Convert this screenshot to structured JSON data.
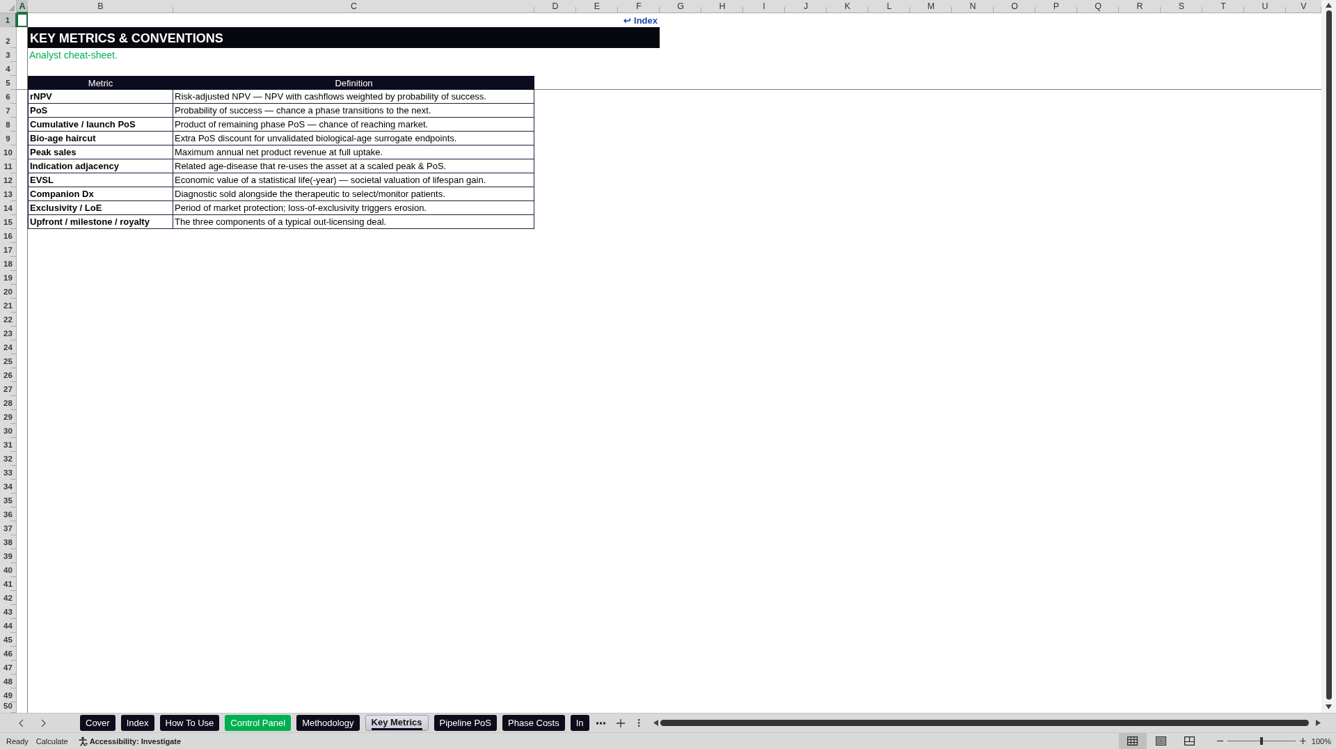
{
  "sheet": {
    "column_headers": [
      {
        "label": "A",
        "selected": true
      },
      {
        "label": "B",
        "selected": false
      },
      {
        "label": "C",
        "selected": false
      },
      {
        "label": "D",
        "selected": false
      },
      {
        "label": "E",
        "selected": false
      },
      {
        "label": "F",
        "selected": false
      },
      {
        "label": "G",
        "selected": false
      },
      {
        "label": "H",
        "selected": false
      },
      {
        "label": "I",
        "selected": false
      },
      {
        "label": "J",
        "selected": false
      },
      {
        "label": "K",
        "selected": false
      },
      {
        "label": "L",
        "selected": false
      },
      {
        "label": "M",
        "selected": false
      },
      {
        "label": "N",
        "selected": false
      },
      {
        "label": "O",
        "selected": false
      },
      {
        "label": "P",
        "selected": false
      },
      {
        "label": "Q",
        "selected": false
      },
      {
        "label": "R",
        "selected": false
      },
      {
        "label": "S",
        "selected": false
      },
      {
        "label": "T",
        "selected": false
      },
      {
        "label": "U",
        "selected": false
      },
      {
        "label": "V",
        "selected": false
      }
    ],
    "row_headers": [
      {
        "label": "1",
        "selected": true
      },
      {
        "label": "2",
        "selected": false
      },
      {
        "label": "3",
        "selected": false
      },
      {
        "label": "4",
        "selected": false
      },
      {
        "label": "5",
        "selected": false
      },
      {
        "label": "6",
        "selected": false
      },
      {
        "label": "7",
        "selected": false
      },
      {
        "label": "8",
        "selected": false
      },
      {
        "label": "9",
        "selected": false
      },
      {
        "label": "10",
        "selected": false
      },
      {
        "label": "11",
        "selected": false
      },
      {
        "label": "12",
        "selected": false
      },
      {
        "label": "13",
        "selected": false
      },
      {
        "label": "14",
        "selected": false
      },
      {
        "label": "15",
        "selected": false
      },
      {
        "label": "16",
        "selected": false
      },
      {
        "label": "17",
        "selected": false
      },
      {
        "label": "18",
        "selected": false
      },
      {
        "label": "19",
        "selected": false
      },
      {
        "label": "20",
        "selected": false
      },
      {
        "label": "21",
        "selected": false
      },
      {
        "label": "22",
        "selected": false
      },
      {
        "label": "23",
        "selected": false
      },
      {
        "label": "24",
        "selected": false
      },
      {
        "label": "25",
        "selected": false
      },
      {
        "label": "26",
        "selected": false
      },
      {
        "label": "27",
        "selected": false
      },
      {
        "label": "28",
        "selected": false
      },
      {
        "label": "29",
        "selected": false
      },
      {
        "label": "30",
        "selected": false
      },
      {
        "label": "31",
        "selected": false
      },
      {
        "label": "32",
        "selected": false
      },
      {
        "label": "33",
        "selected": false
      },
      {
        "label": "34",
        "selected": false
      },
      {
        "label": "35",
        "selected": false
      },
      {
        "label": "36",
        "selected": false
      },
      {
        "label": "37",
        "selected": false
      },
      {
        "label": "38",
        "selected": false
      },
      {
        "label": "39",
        "selected": false
      },
      {
        "label": "40",
        "selected": false
      },
      {
        "label": "41",
        "selected": false
      },
      {
        "label": "42",
        "selected": false
      },
      {
        "label": "43",
        "selected": false
      },
      {
        "label": "44",
        "selected": false
      },
      {
        "label": "45",
        "selected": false
      },
      {
        "label": "46",
        "selected": false
      },
      {
        "label": "47",
        "selected": false
      },
      {
        "label": "48",
        "selected": false
      },
      {
        "label": "49",
        "selected": false
      },
      {
        "label": "50",
        "selected": false
      }
    ]
  },
  "index_link": {
    "label": "↩ Index"
  },
  "title": "KEY METRICS & CONVENTIONS",
  "subtitle": "Analyst cheat-sheet.",
  "table": {
    "columns": [
      "Metric",
      "Definition"
    ],
    "rows": [
      {
        "metric": "rNPV",
        "definition": "Risk-adjusted NPV — NPV with cashflows weighted by probability of success."
      },
      {
        "metric": "PoS",
        "definition": "Probability of success — chance a phase transitions to the next."
      },
      {
        "metric": "Cumulative / launch PoS",
        "definition": "Product of remaining phase PoS — chance of reaching market."
      },
      {
        "metric": "Bio-age haircut",
        "definition": "Extra PoS discount for unvalidated biological-age surrogate endpoints."
      },
      {
        "metric": "Peak sales",
        "definition": "Maximum annual net product revenue at full uptake."
      },
      {
        "metric": "Indication adjacency",
        "definition": "Related age-disease that re-uses the asset at a scaled peak & PoS."
      },
      {
        "metric": "EVSL",
        "definition": "Economic value of a statistical life(-year) — societal valuation of lifespan gain."
      },
      {
        "metric": "Companion Dx",
        "definition": "Diagnostic sold alongside the therapeutic to select/monitor patients."
      },
      {
        "metric": "Exclusivity / LoE",
        "definition": "Period of market protection; loss-of-exclusivity triggers erosion."
      },
      {
        "metric": "Upfront / milestone / royalty",
        "definition": "The three components of a typical out-licensing deal."
      }
    ]
  },
  "sheet_tabs": [
    {
      "label": "Cover",
      "selected": false,
      "color": "#0c0c1a"
    },
    {
      "label": "Index",
      "selected": false,
      "color": "#0c0c1a"
    },
    {
      "label": "How To Use",
      "selected": false,
      "color": "#0c0c1a"
    },
    {
      "label": "Control Panel",
      "selected": false,
      "color": "#00b050"
    },
    {
      "label": "Methodology",
      "selected": false,
      "color": "#0c0c1a"
    },
    {
      "label": "Key Metrics",
      "selected": true,
      "color": "#0c0c1a"
    },
    {
      "label": "Pipeline PoS",
      "selected": false,
      "color": "#0c0c1a"
    },
    {
      "label": "Phase Costs",
      "selected": false,
      "color": "#0c0c1a"
    },
    {
      "label": "In",
      "selected": false,
      "color": "#0c0c1a"
    }
  ],
  "status_bar": {
    "mode": "Ready",
    "calculate": "Calculate",
    "accessibility": "Accessibility: Investigate",
    "views": [
      {
        "kind": "normal",
        "selected": true
      },
      {
        "kind": "page_layout",
        "selected": false
      },
      {
        "kind": "page_break_preview",
        "selected": false
      }
    ],
    "zoom_slider": {
      "level": 0.5
    },
    "zoom": "100%"
  }
}
